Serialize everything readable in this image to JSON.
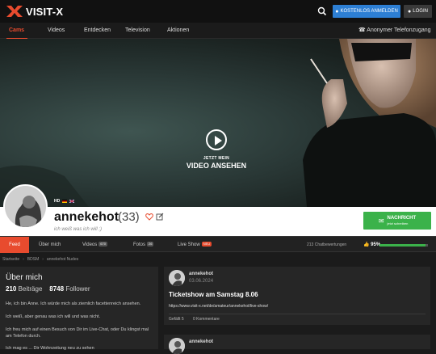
{
  "brand": {
    "logo_text": "VISIT-X",
    "accent": "#e84b2e",
    "primary_blue": "#2d7fd4",
    "success_green": "#3bb24a"
  },
  "header": {
    "search_icon": "search-icon",
    "register_label": "KOSTENLOS ANMELDEN",
    "login_label": "LOGIN"
  },
  "nav": {
    "items": [
      {
        "label": "Cams",
        "active": true
      },
      {
        "label": "Videos"
      },
      {
        "label": "Entdecken"
      },
      {
        "label": "Television"
      },
      {
        "label": "Aktionen"
      }
    ],
    "phone_label": "Anonymer Telefonzugang"
  },
  "hero": {
    "cta_line1": "JETZT MEIN",
    "cta_line2": "VIDEO ANSEHEN"
  },
  "profile": {
    "hd_badge": "HD",
    "name": "annekehot",
    "age": "(33)",
    "tagline": "ich weiß was ich will ;)",
    "message_label": "NACHRICHT",
    "message_sub": "jetzt schreiben"
  },
  "tabs": {
    "feed": "Feed",
    "about": "Über mich",
    "videos": "Videos",
    "videos_count": "670",
    "fotos": "Fotos",
    "fotos_count": "26",
    "live": "Live Show",
    "live_badge": "NEU",
    "rating_count": "213 Chatbewertungen",
    "rating_value": "95%",
    "rating_fraction": 0.95
  },
  "breadcrumb": [
    "Startseite",
    "BDSM",
    "annekehot Nudes"
  ],
  "about": {
    "title": "Über mich",
    "posts_count": "210",
    "posts_label": "Beiträge",
    "followers_count": "8748",
    "followers_label": "Follower",
    "text1": "He, ich bin Anne. Ich würde mich als ziemlich facettenreich ansehen.",
    "text2": "Ich weiß, aber genau was ich will und was nicht.",
    "text3": "Ich freu mich auf einen Besuch von Dir im Live-Chat, oder Du klingst mal am Telefon durch.",
    "text4": "Ich mag es ... Dir Wohnzeitung neu zu sehen"
  },
  "posts": [
    {
      "author": "annekehot",
      "date": "03.06.2024",
      "title": "Ticketshow am Samstag 8.06",
      "link": "https://www.visit-x.net/de/amateur/annekehot/live-show/",
      "likes": "Gefällt 5",
      "comments": "0 Kommentare"
    },
    {
      "author": "annekehot"
    }
  ]
}
